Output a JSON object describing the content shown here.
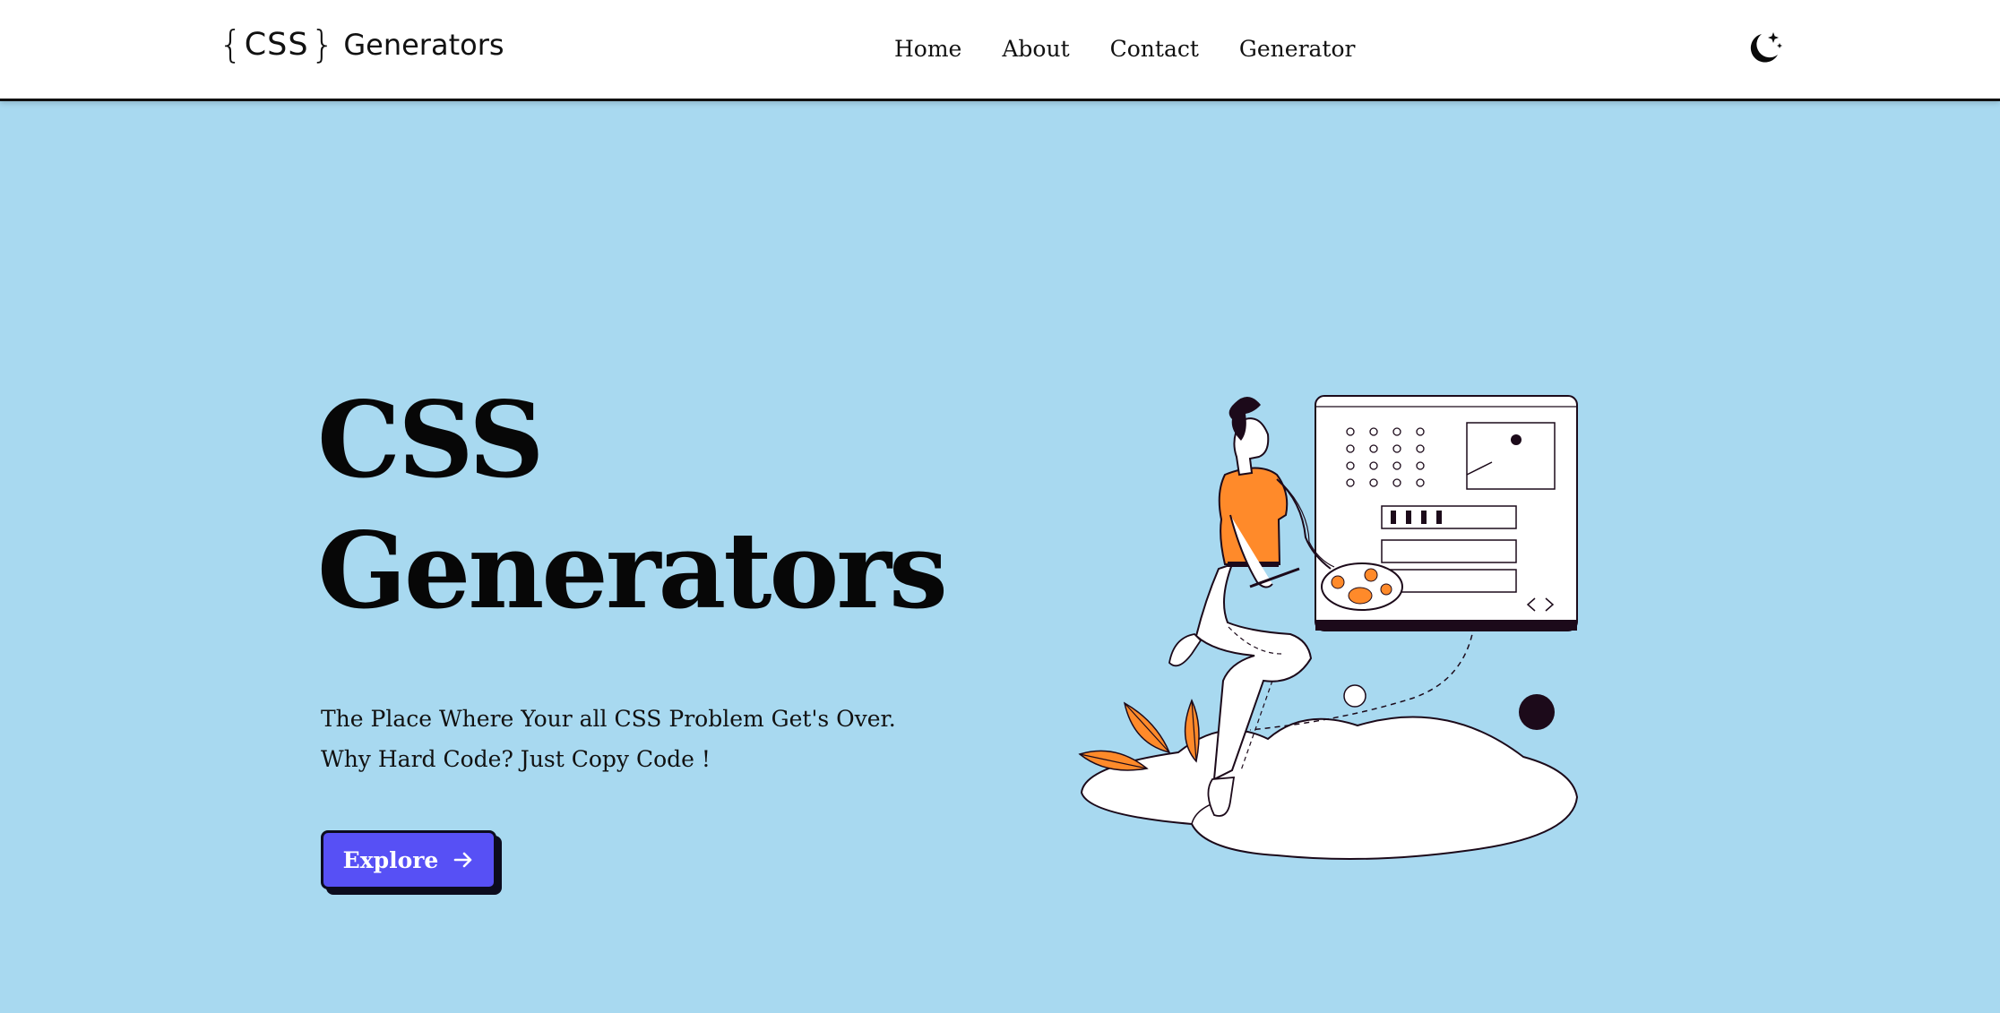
{
  "header": {
    "logo": {
      "brace_open": "{",
      "brand": "CSS",
      "brace_close": "}",
      "name": "Generators"
    },
    "nav": [
      {
        "label": "Home"
      },
      {
        "label": "About"
      },
      {
        "label": "Contact"
      },
      {
        "label": "Generator"
      }
    ],
    "theme_toggle_icon": "moon-stars-icon"
  },
  "hero": {
    "title_line1": "CSS",
    "title_line2": "Generators",
    "tagline_line1": "The Place Where Your all CSS Problem Get's Over.",
    "tagline_line2": "Why Hard Code? Just Copy Code !",
    "cta_label": "Explore",
    "cta_icon": "arrow-right-icon",
    "illustration": "designer-with-palette-illustration"
  },
  "colors": {
    "background": "#a8d9f0",
    "header": "#ffffff",
    "accent": "#5750f5",
    "illustration_orange": "#ff8a2a",
    "ink": "#1c0a1a"
  }
}
